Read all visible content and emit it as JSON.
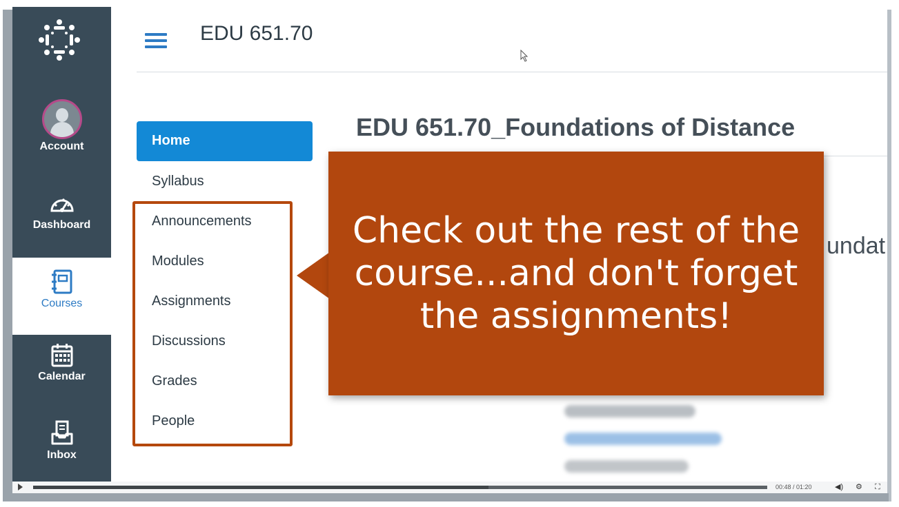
{
  "global_nav": {
    "items": [
      {
        "label": "Account"
      },
      {
        "label": "Dashboard"
      },
      {
        "label": "Courses"
      },
      {
        "label": "Calendar"
      },
      {
        "label": "Inbox"
      }
    ],
    "active": "Courses"
  },
  "header": {
    "course_code": "EDU 651.70"
  },
  "course_nav": {
    "items": [
      {
        "label": "Home"
      },
      {
        "label": "Syllabus"
      },
      {
        "label": "Announcements"
      },
      {
        "label": "Modules"
      },
      {
        "label": "Assignments"
      },
      {
        "label": "Discussions"
      },
      {
        "label": "Grades"
      },
      {
        "label": "People"
      }
    ],
    "active": "Home"
  },
  "main": {
    "course_title": "EDU 651.70_Foundations of Distance",
    "partial_text": "undat"
  },
  "callout": {
    "text": "Check out the rest of the course...and don't forget the assignments!"
  },
  "player": {
    "time": "00:48 / 01:20",
    "progress": 0.62
  },
  "colors": {
    "nav_bg": "#394b58",
    "brand_blue": "#1389d6",
    "callout_bg": "#b2470e",
    "highlight_border": "#b5480d"
  }
}
